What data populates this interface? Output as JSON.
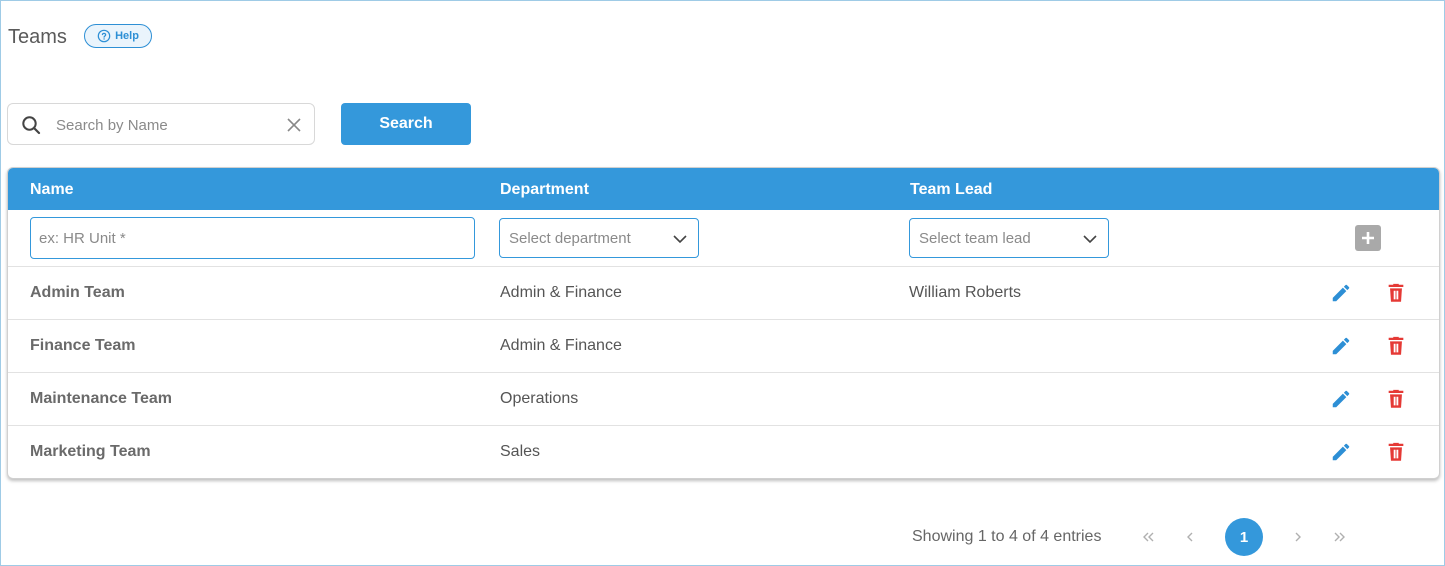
{
  "header": {
    "title": "Teams",
    "help_label": "Help"
  },
  "search": {
    "placeholder": "Search by Name",
    "value": "",
    "button_label": "Search"
  },
  "table": {
    "columns": [
      "Name",
      "Department",
      "Team Lead"
    ],
    "new_row": {
      "name_placeholder": "ex: HR Unit *",
      "department_placeholder": "Select department",
      "team_lead_placeholder": "Select team lead"
    },
    "rows": [
      {
        "name": "Admin Team",
        "department": "Admin & Finance",
        "team_lead": "William Roberts"
      },
      {
        "name": "Finance Team",
        "department": "Admin & Finance",
        "team_lead": ""
      },
      {
        "name": "Maintenance Team",
        "department": "Operations",
        "team_lead": ""
      },
      {
        "name": "Marketing Team",
        "department": "Sales",
        "team_lead": ""
      }
    ]
  },
  "pagination": {
    "summary": "Showing 1 to 4 of 4 entries",
    "current_page": "1"
  },
  "colors": {
    "accent": "#3498db",
    "delete": "#e53935",
    "edit": "#2d8fd5",
    "add_button": "#a9a9a9"
  }
}
